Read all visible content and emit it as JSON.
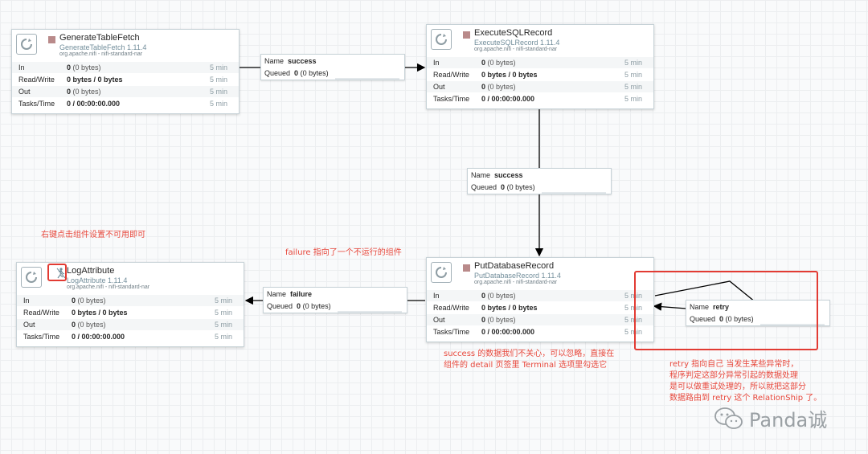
{
  "processors": {
    "generate": {
      "name": "GenerateTableFetch",
      "type": "GenerateTableFetch 1.11.4",
      "bundle": "org.apache.nifi - nifi-standard-nar",
      "in_label": "In",
      "in_value": "0",
      "in_paren": "(0 bytes)",
      "in_time": "5 min",
      "rw_label": "Read/Write",
      "rw_value": "0 bytes / 0 bytes",
      "rw_time": "5 min",
      "out_label": "Out",
      "out_value": "0",
      "out_paren": "(0 bytes)",
      "out_time": "5 min",
      "tasks_label": "Tasks/Time",
      "tasks_value": "0 / 00:00:00.000",
      "tasks_time": "5 min"
    },
    "execute": {
      "name": "ExecuteSQLRecord",
      "type": "ExecuteSQLRecord 1.11.4",
      "bundle": "org.apache.nifi - nifi-standard-nar",
      "in_label": "In",
      "in_value": "0",
      "in_paren": "(0 bytes)",
      "in_time": "5 min",
      "rw_label": "Read/Write",
      "rw_value": "0 bytes / 0 bytes",
      "rw_time": "5 min",
      "out_label": "Out",
      "out_value": "0",
      "out_paren": "(0 bytes)",
      "out_time": "5 min",
      "tasks_label": "Tasks/Time",
      "tasks_value": "0 / 00:00:00.000",
      "tasks_time": "5 min"
    },
    "put": {
      "name": "PutDatabaseRecord",
      "type": "PutDatabaseRecord 1.11.4",
      "bundle": "org.apache.nifi - nifi-standard-nar",
      "in_label": "In",
      "in_value": "0",
      "in_paren": "(0 bytes)",
      "in_time": "5 min",
      "rw_label": "Read/Write",
      "rw_value": "0 bytes / 0 bytes",
      "rw_time": "5 min",
      "out_label": "Out",
      "out_value": "0",
      "out_paren": "(0 bytes)",
      "out_time": "5 min",
      "tasks_label": "Tasks/Time",
      "tasks_value": "0 / 00:00:00.000",
      "tasks_time": "5 min"
    },
    "log": {
      "name": "LogAttribute",
      "type": "LogAttribute 1.11.4",
      "bundle": "org.apache.nifi - nifi-standard-nar",
      "in_label": "In",
      "in_value": "0",
      "in_paren": "(0 bytes)",
      "in_time": "5 min",
      "rw_label": "Read/Write",
      "rw_value": "0 bytes / 0 bytes",
      "rw_time": "5 min",
      "out_label": "Out",
      "out_value": "0",
      "out_paren": "(0 bytes)",
      "out_time": "5 min",
      "tasks_label": "Tasks/Time",
      "tasks_value": "0 / 00:00:00.000",
      "tasks_time": "5 min"
    }
  },
  "connections": {
    "success1": {
      "name_label": "Name",
      "name_value": "success",
      "queued_label": "Queued",
      "queued_value": "0",
      "queued_paren": "(0 bytes)"
    },
    "success2": {
      "name_label": "Name",
      "name_value": "success",
      "queued_label": "Queued",
      "queued_value": "0",
      "queued_paren": "(0 bytes)"
    },
    "failure": {
      "name_label": "Name",
      "name_value": "failure",
      "queued_label": "Queued",
      "queued_value": "0",
      "queued_paren": "(0 bytes)"
    },
    "retry": {
      "name_label": "Name",
      "name_value": "retry",
      "queued_label": "Queued",
      "queued_value": "0",
      "queued_paren": "(0 bytes)"
    }
  },
  "annotations": {
    "disable_note": "右键点击组件设置不可用即可",
    "failure_note": "failure 指向了一个不运行的组件",
    "success_note_1": "success 的数据我们不关心，可以忽略，直接在",
    "success_note_2": "组件的 detail 页签里 Terminal 选项里勾选它",
    "retry_note_1": "retry 指向自己 当发生某些异常时，",
    "retry_note_2": "程序判定这部分异常引起的数据处理",
    "retry_note_3": "是可以做重试处理的，所以就把这部分",
    "retry_note_4": "数据路由到 retry 这个 RelationShip 了。"
  },
  "watermark": {
    "text": "Panda诚",
    "icon": "wechat-icon"
  },
  "colors": {
    "annotation": "#e8483c",
    "stopped": "#b98a8a",
    "accent": "#728e9b"
  }
}
